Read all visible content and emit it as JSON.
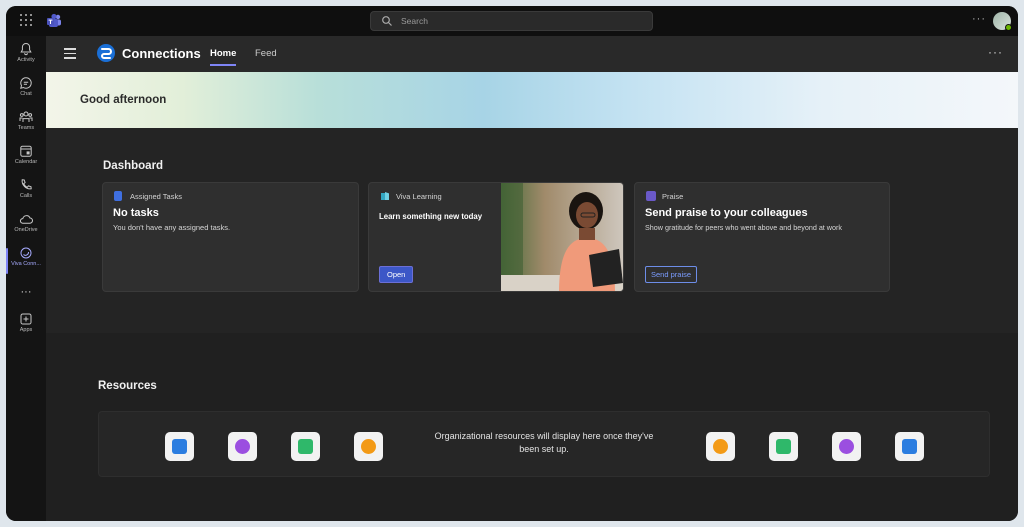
{
  "topbar": {
    "search_placeholder": "Search",
    "more": "···"
  },
  "rail": [
    {
      "name": "activity",
      "label": "Activity"
    },
    {
      "name": "chat",
      "label": "Chat"
    },
    {
      "name": "teams",
      "label": "Teams"
    },
    {
      "name": "calendar",
      "label": "Calendar"
    },
    {
      "name": "calls",
      "label": "Calls"
    },
    {
      "name": "onedrive",
      "label": "OneDrive"
    },
    {
      "name": "viva-connections",
      "label": "Viva Conn..."
    },
    {
      "name": "more",
      "label": "···"
    },
    {
      "name": "apps",
      "label": "Apps"
    }
  ],
  "app": {
    "title": "Connections",
    "tabs": [
      "Home",
      "Feed"
    ],
    "more": "···",
    "greeting": "Good afternoon"
  },
  "dashboard": {
    "title": "Dashboard",
    "cards": [
      {
        "tag": "Assigned Tasks",
        "title": "No tasks",
        "description": "You don't have any assigned tasks."
      },
      {
        "tag": "Viva Learning",
        "title": "Learn something new today",
        "button": "Open"
      },
      {
        "tag": "Praise",
        "title": "Send praise to your colleagues",
        "description": "Show gratitude for peers who went above and beyond at work",
        "button": "Send praise"
      }
    ]
  },
  "resources": {
    "title": "Resources",
    "message": "Organizational resources will display here once they've been set up.",
    "tiles_left": [
      "blue-square-icon",
      "purple-circle-icon",
      "green-square-icon",
      "orange-circle-icon"
    ],
    "tiles_right": [
      "orange-circle-icon",
      "green-square-icon",
      "purple-circle-icon",
      "blue-square-icon"
    ]
  },
  "colors": {
    "accent": "#7f85f5",
    "primary_button": "#3c57c7",
    "hero_teal": "#a7d4e6"
  }
}
